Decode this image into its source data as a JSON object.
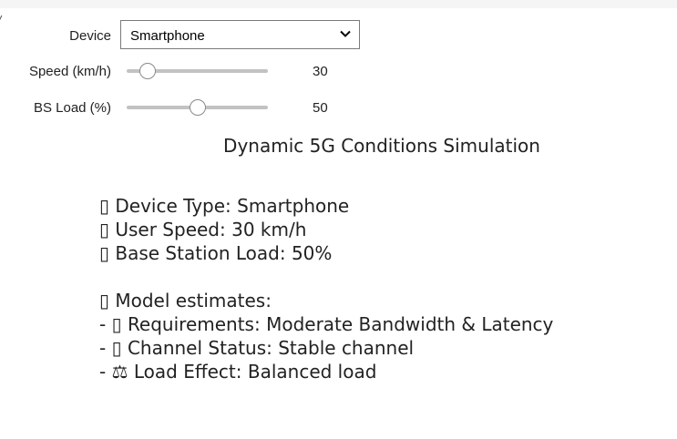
{
  "controls": {
    "device": {
      "label": "Device",
      "value": "Smartphone"
    },
    "speed": {
      "label": "Speed (km/h)",
      "value": "30",
      "level": 0.1
    },
    "load": {
      "label": "BS Load (%)",
      "value": "50",
      "level": 0.5
    }
  },
  "output": {
    "title": "Dynamic 5G Conditions Simulation",
    "lines": [
      "▯ Device Type: Smartphone",
      "▯ User Speed: 30 km/h",
      "▯ Base Station Load: 50%",
      "▯ Model estimates:",
      "- ▯ Requirements: Moderate Bandwidth & Latency",
      "- ▯ Channel Status: Stable channel",
      "- ⚖ Load Effect: Balanced load"
    ]
  },
  "icons": {
    "select": "chevron-down-icon"
  }
}
